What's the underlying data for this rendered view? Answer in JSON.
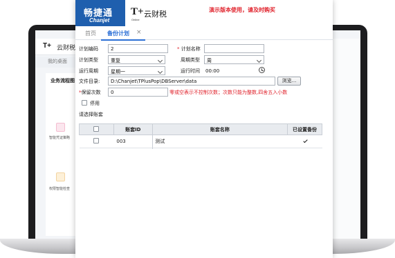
{
  "background_app": {
    "logo": "T+",
    "logo_text": "云财税",
    "tab": "我的桌面",
    "section_title": "业务流程图",
    "items": [
      {
        "label": "智能凭证策略"
      },
      {
        "label": "权限智能检查"
      }
    ]
  },
  "header": {
    "brand_cn": "畅捷通",
    "brand_en": "Chanjet",
    "product_mark": "T+",
    "product_mark_sub": "Online",
    "product_name": "云财税",
    "demo_notice": "演示版本使用，请及时购买"
  },
  "tabs": [
    {
      "label": "首页",
      "active": false
    },
    {
      "label": "备份计划",
      "active": true,
      "close": "×"
    }
  ],
  "form": {
    "plan_code_label": "计划编码",
    "plan_code_value": "2",
    "plan_name_label": "* 计划名称",
    "plan_name_value": "",
    "plan_type_label": "计划类型",
    "plan_type_value": "重复",
    "cycle_type_label": "周期类型",
    "cycle_type_value": "周",
    "run_cycle_label": "运行周期",
    "run_cycle_value": "星期一",
    "run_time_label": "运行时间",
    "run_time_value": "00:00",
    "file_dir_label": "文件目录:",
    "file_dir_value": "D:\\Chanjet\\TPlusPop\\DBServer\\data",
    "browse_label": "浏览...",
    "retain_label": "*保留次数",
    "retain_value": "0",
    "retain_hint": "零或空表示不控制次数；次数只能为整数,四舍五入小数",
    "disable_label": "停用",
    "select_accounts_label": "请选择账套"
  },
  "table": {
    "headers": [
      "",
      "账套ID",
      "账套名称",
      "已设置备份"
    ],
    "rows": [
      {
        "id": "003",
        "name": "测试",
        "backup_set": true
      }
    ]
  },
  "colors": {
    "brand_blue": "#1f5fae",
    "active_tab": "#2b6fd6",
    "notice_red": "#e0202a"
  }
}
